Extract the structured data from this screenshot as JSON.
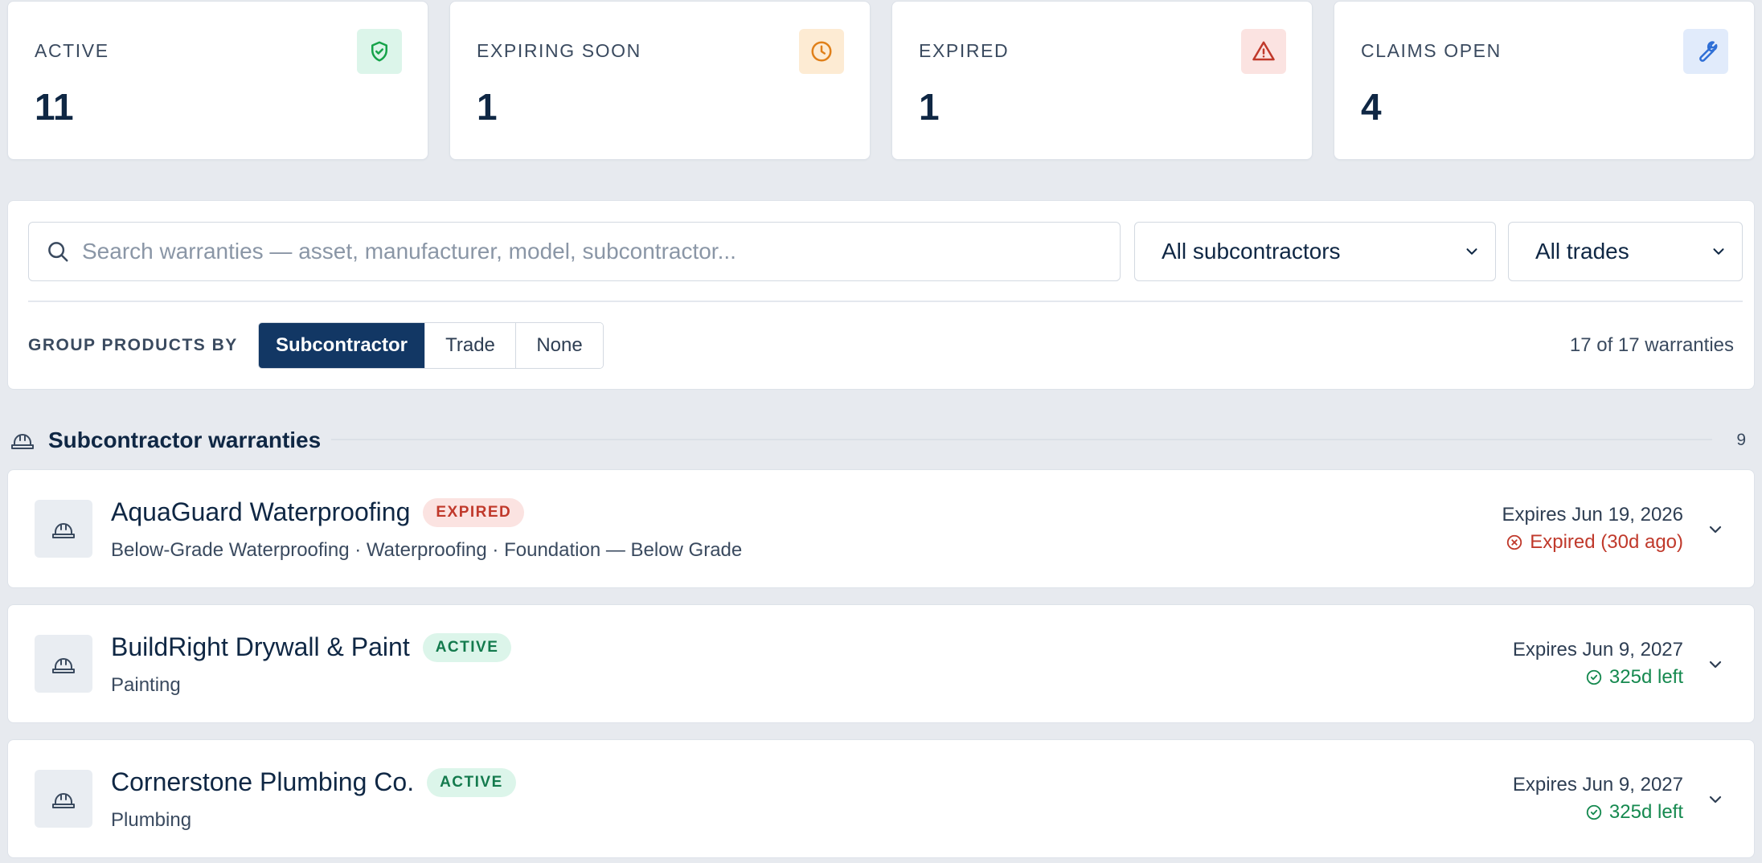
{
  "stats": [
    {
      "label": "ACTIVE",
      "value": "11",
      "icon": "shield-check-icon",
      "color": "#16a34a",
      "bg": "#dcf5ea"
    },
    {
      "label": "EXPIRING SOON",
      "value": "1",
      "icon": "clock-icon",
      "color": "#e0801a",
      "bg": "#fdebd3"
    },
    {
      "label": "EXPIRED",
      "value": "1",
      "icon": "alert-triangle-icon",
      "color": "#c0392b",
      "bg": "#fbe3e1"
    },
    {
      "label": "CLAIMS OPEN",
      "value": "4",
      "icon": "wrench-icon",
      "color": "#2f6fd6",
      "bg": "#e1ebfb"
    }
  ],
  "filters": {
    "search_placeholder": "Search warranties — asset, manufacturer, model, subcontractor...",
    "subcontractor_select": "All subcontractors",
    "trade_select": "All trades",
    "group_label": "GROUP PRODUCTS BY",
    "group_options": [
      "Subcontractor",
      "Trade",
      "None"
    ],
    "group_selected": "Subcontractor",
    "count_text": "17 of 17 warranties"
  },
  "section": {
    "title": "Subcontractor warranties",
    "count": "9",
    "icon": "hard-hat-icon"
  },
  "warranties": [
    {
      "name": "AquaGuard Waterproofing",
      "badge": "EXPIRED",
      "subtitle": "Below-Grade Waterproofing · Waterproofing · Foundation — Below Grade",
      "expires": "Expires Jun 19, 2026",
      "status": "Expired (30d ago)",
      "status_kind": "expired"
    },
    {
      "name": "BuildRight Drywall & Paint",
      "badge": "ACTIVE",
      "subtitle": "Painting",
      "expires": "Expires Jun 9, 2027",
      "status": "325d left",
      "status_kind": "active"
    },
    {
      "name": "Cornerstone Plumbing Co.",
      "badge": "ACTIVE",
      "subtitle": "Plumbing",
      "expires": "Expires Jun 9, 2027",
      "status": "325d left",
      "status_kind": "active"
    }
  ],
  "colors": {
    "accent": "#123764",
    "expired": "#c0392b",
    "active": "#15894f"
  }
}
